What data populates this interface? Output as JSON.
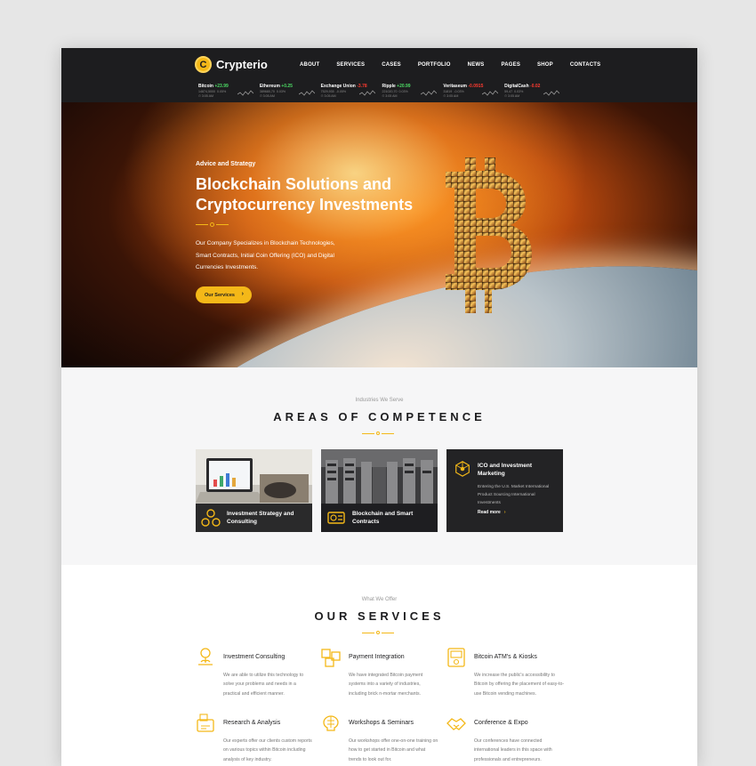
{
  "brand": {
    "name": "Crypterio",
    "mark": "C"
  },
  "nav": [
    "ABOUT",
    "SERVICES",
    "CASES",
    "PORTFOLIO",
    "NEWS",
    "PAGES",
    "SHOP",
    "CONTACTS"
  ],
  "ticker": [
    {
      "name": "Bitcoin",
      "change": "+23.99",
      "dir": "up",
      "price": "14874,5000",
      "pct": "0.05%",
      "time": "3:05 AM"
    },
    {
      "name": "Ethereum",
      "change": "+0.25",
      "dir": "up",
      "price": "389680,70",
      "pct": "0.03%",
      "time": "3:05 AM"
    },
    {
      "name": "Exchange Union",
      "change": "-3.78",
      "dir": "down",
      "price": "7529,935",
      "pct": "-0.05%",
      "time": "3:05 AM"
    },
    {
      "name": "Ripple",
      "change": "+20.99",
      "dir": "up",
      "price": "221020,70",
      "pct": "0.03%",
      "time": "3:05 AM"
    },
    {
      "name": "Veritaseum",
      "change": "-0.0915",
      "dir": "down",
      "price": "31819",
      "pct": "-0.03%",
      "time": "3:05 AM"
    },
    {
      "name": "DigitalCash",
      "change": "-0.02",
      "dir": "down",
      "price": "59,47",
      "pct": "0.03%",
      "time": "3:05 AM"
    }
  ],
  "colors": {
    "accent": "#f4b818",
    "dark": "#1d1d1f",
    "up": "#4cd964",
    "down": "#ff3b30"
  },
  "hero": {
    "eyebrow": "Advice and Strategy",
    "title": "Blockchain Solutions and Cryptocurrency Investments",
    "description": "Our Company Specializes in Blockchain Technologies, Smart Contracts, Initial Coin Offering (ICO) and Digital Currencies Investments.",
    "button": "Our Services",
    "icon": "bitcoin-icon"
  },
  "competence": {
    "eyebrow": "Industries We Serve",
    "title": "AREAS OF COMPETENCE",
    "cards": [
      {
        "label": "Investment Strategy and Consulting",
        "icon": "coins-network-icon"
      },
      {
        "label": "Blockchain and Smart Contracts",
        "icon": "contract-chip-icon"
      },
      {
        "label": "ICO and Investment Marketing",
        "icon": "network-hex-icon",
        "text": "Entering the U.S. Market International Product Sourcing International Investments",
        "more": "Read more"
      }
    ]
  },
  "services": {
    "eyebrow": "What We Offer",
    "title": "OUR SERVICES",
    "items": [
      {
        "title": "Investment Consulting",
        "text": "We are able to utilize this technology to solve your problems and needs in a practical and efficient manner.",
        "icon": "money-plant-icon"
      },
      {
        "title": "Payment Integration",
        "text": "We have integrated Bitcoin payment systems into a variety of industries, including brick n-mortar merchants.",
        "icon": "payment-blocks-icon"
      },
      {
        "title": "Bitcoin ATM's & Kiosks",
        "text": "We increase the public's accessibility to Bitcoin by offering the placement of easy-to-use Bitcoin vending machines.",
        "icon": "atm-icon"
      },
      {
        "title": "Research & Analysis",
        "text": "Our experts offer our clients custom reports on various topics within Bitcoin including analysis of key industry.",
        "icon": "research-icon"
      },
      {
        "title": "Workshops & Seminars",
        "text": "Our workshops offer one-on-one training on how to get started in Bitcoin and what trends to look out for.",
        "icon": "brain-icon"
      },
      {
        "title": "Conference & Expo",
        "text": "Our conferences have connected international leaders in this space with professionals and entrepreneurs.",
        "icon": "handshake-icon"
      }
    ]
  }
}
